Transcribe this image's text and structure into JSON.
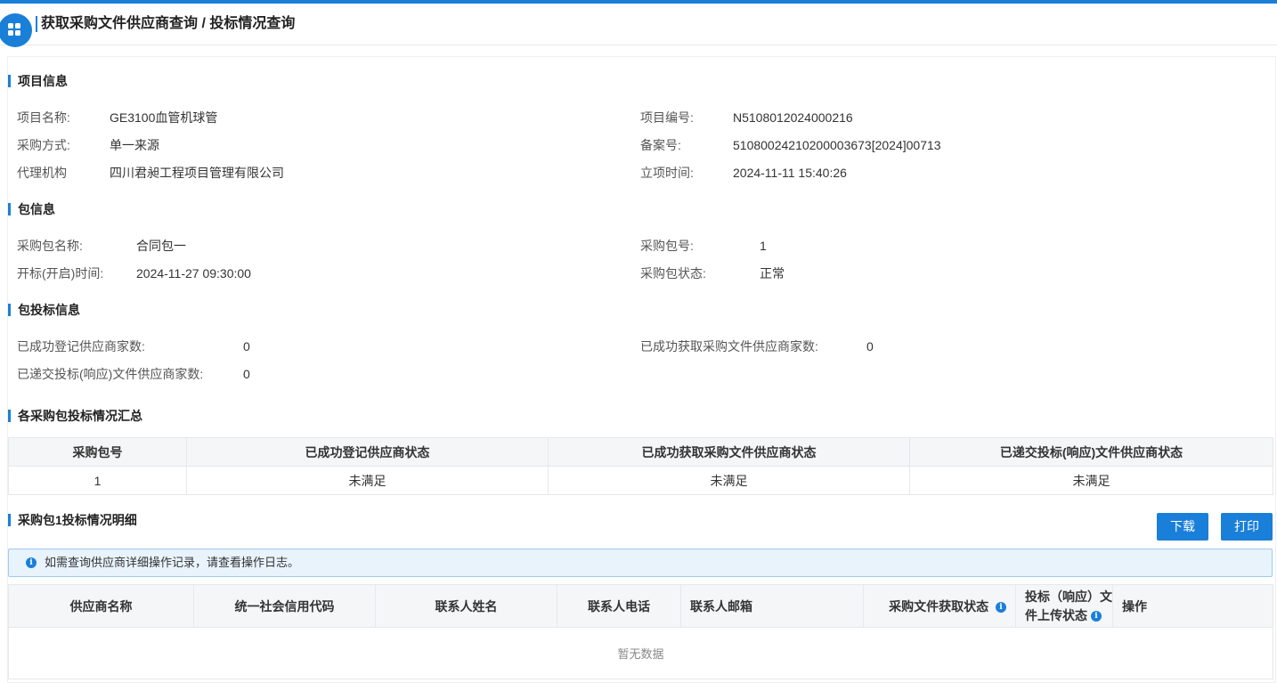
{
  "header": {
    "title": "获取采购文件供应商查询 / 投标情况查询"
  },
  "project_info": {
    "title": "项目信息",
    "project_name_label": "项目名称:",
    "project_name": "GE3100血管机球管",
    "project_no_label": "项目编号:",
    "project_no": "N5108012024000216",
    "method_label": "采购方式:",
    "method": "单一来源",
    "record_no_label": "备案号:",
    "record_no": "51080024210200003673[2024]00713",
    "agency_label": "代理机构",
    "agency": "四川君昶工程项目管理有限公司",
    "setup_time_label": "立项时间:",
    "setup_time": "2024-11-11 15:40:26"
  },
  "package_info": {
    "title": "包信息",
    "pkg_name_label": "采购包名称:",
    "pkg_name": "合同包一",
    "pkg_no_label": "采购包号:",
    "pkg_no": "1",
    "open_time_label": "开标(开启)时间:",
    "open_time": "2024-11-27 09:30:00",
    "pkg_status_label": "采购包状态:",
    "pkg_status": "正常"
  },
  "bid_info": {
    "title": "包投标信息",
    "registered_label": "已成功登记供应商家数:",
    "registered": "0",
    "obtained_label": "已成功获取采购文件供应商家数:",
    "obtained": "0",
    "submitted_label": "已递交投标(响应)文件供应商家数:",
    "submitted": "0"
  },
  "summary": {
    "title": "各采购包投标情况汇总",
    "columns": [
      "采购包号",
      "已成功登记供应商状态",
      "已成功获取采购文件供应商状态",
      "已递交投标(响应)文件供应商状态"
    ],
    "rows": [
      [
        "1",
        "未满足",
        "未满足",
        "未满足"
      ]
    ]
  },
  "detail": {
    "title": "采购包1投标情况明细",
    "download_label": "下载",
    "print_label": "打印",
    "notice": "如需查询供应商详细操作记录，请查看操作日志。",
    "columns": {
      "supplier_name": "供应商名称",
      "credit_code": "统一社会信用代码",
      "contact_name": "联系人姓名",
      "contact_phone": "联系人电话",
      "contact_email": "联系人邮箱",
      "file_status": "采购文件获取状态",
      "upload_status_line1": "投标（响应）文",
      "upload_status_line2": "件上传状态",
      "action": "操作"
    },
    "empty_text": "暂无数据"
  },
  "colors": {
    "accent": "#1a7fd9",
    "notice_bg": "#e8f3fc",
    "notice_border": "#9fc9ee"
  },
  "icons": {
    "app": "grid-icon",
    "notice": "info-icon"
  }
}
